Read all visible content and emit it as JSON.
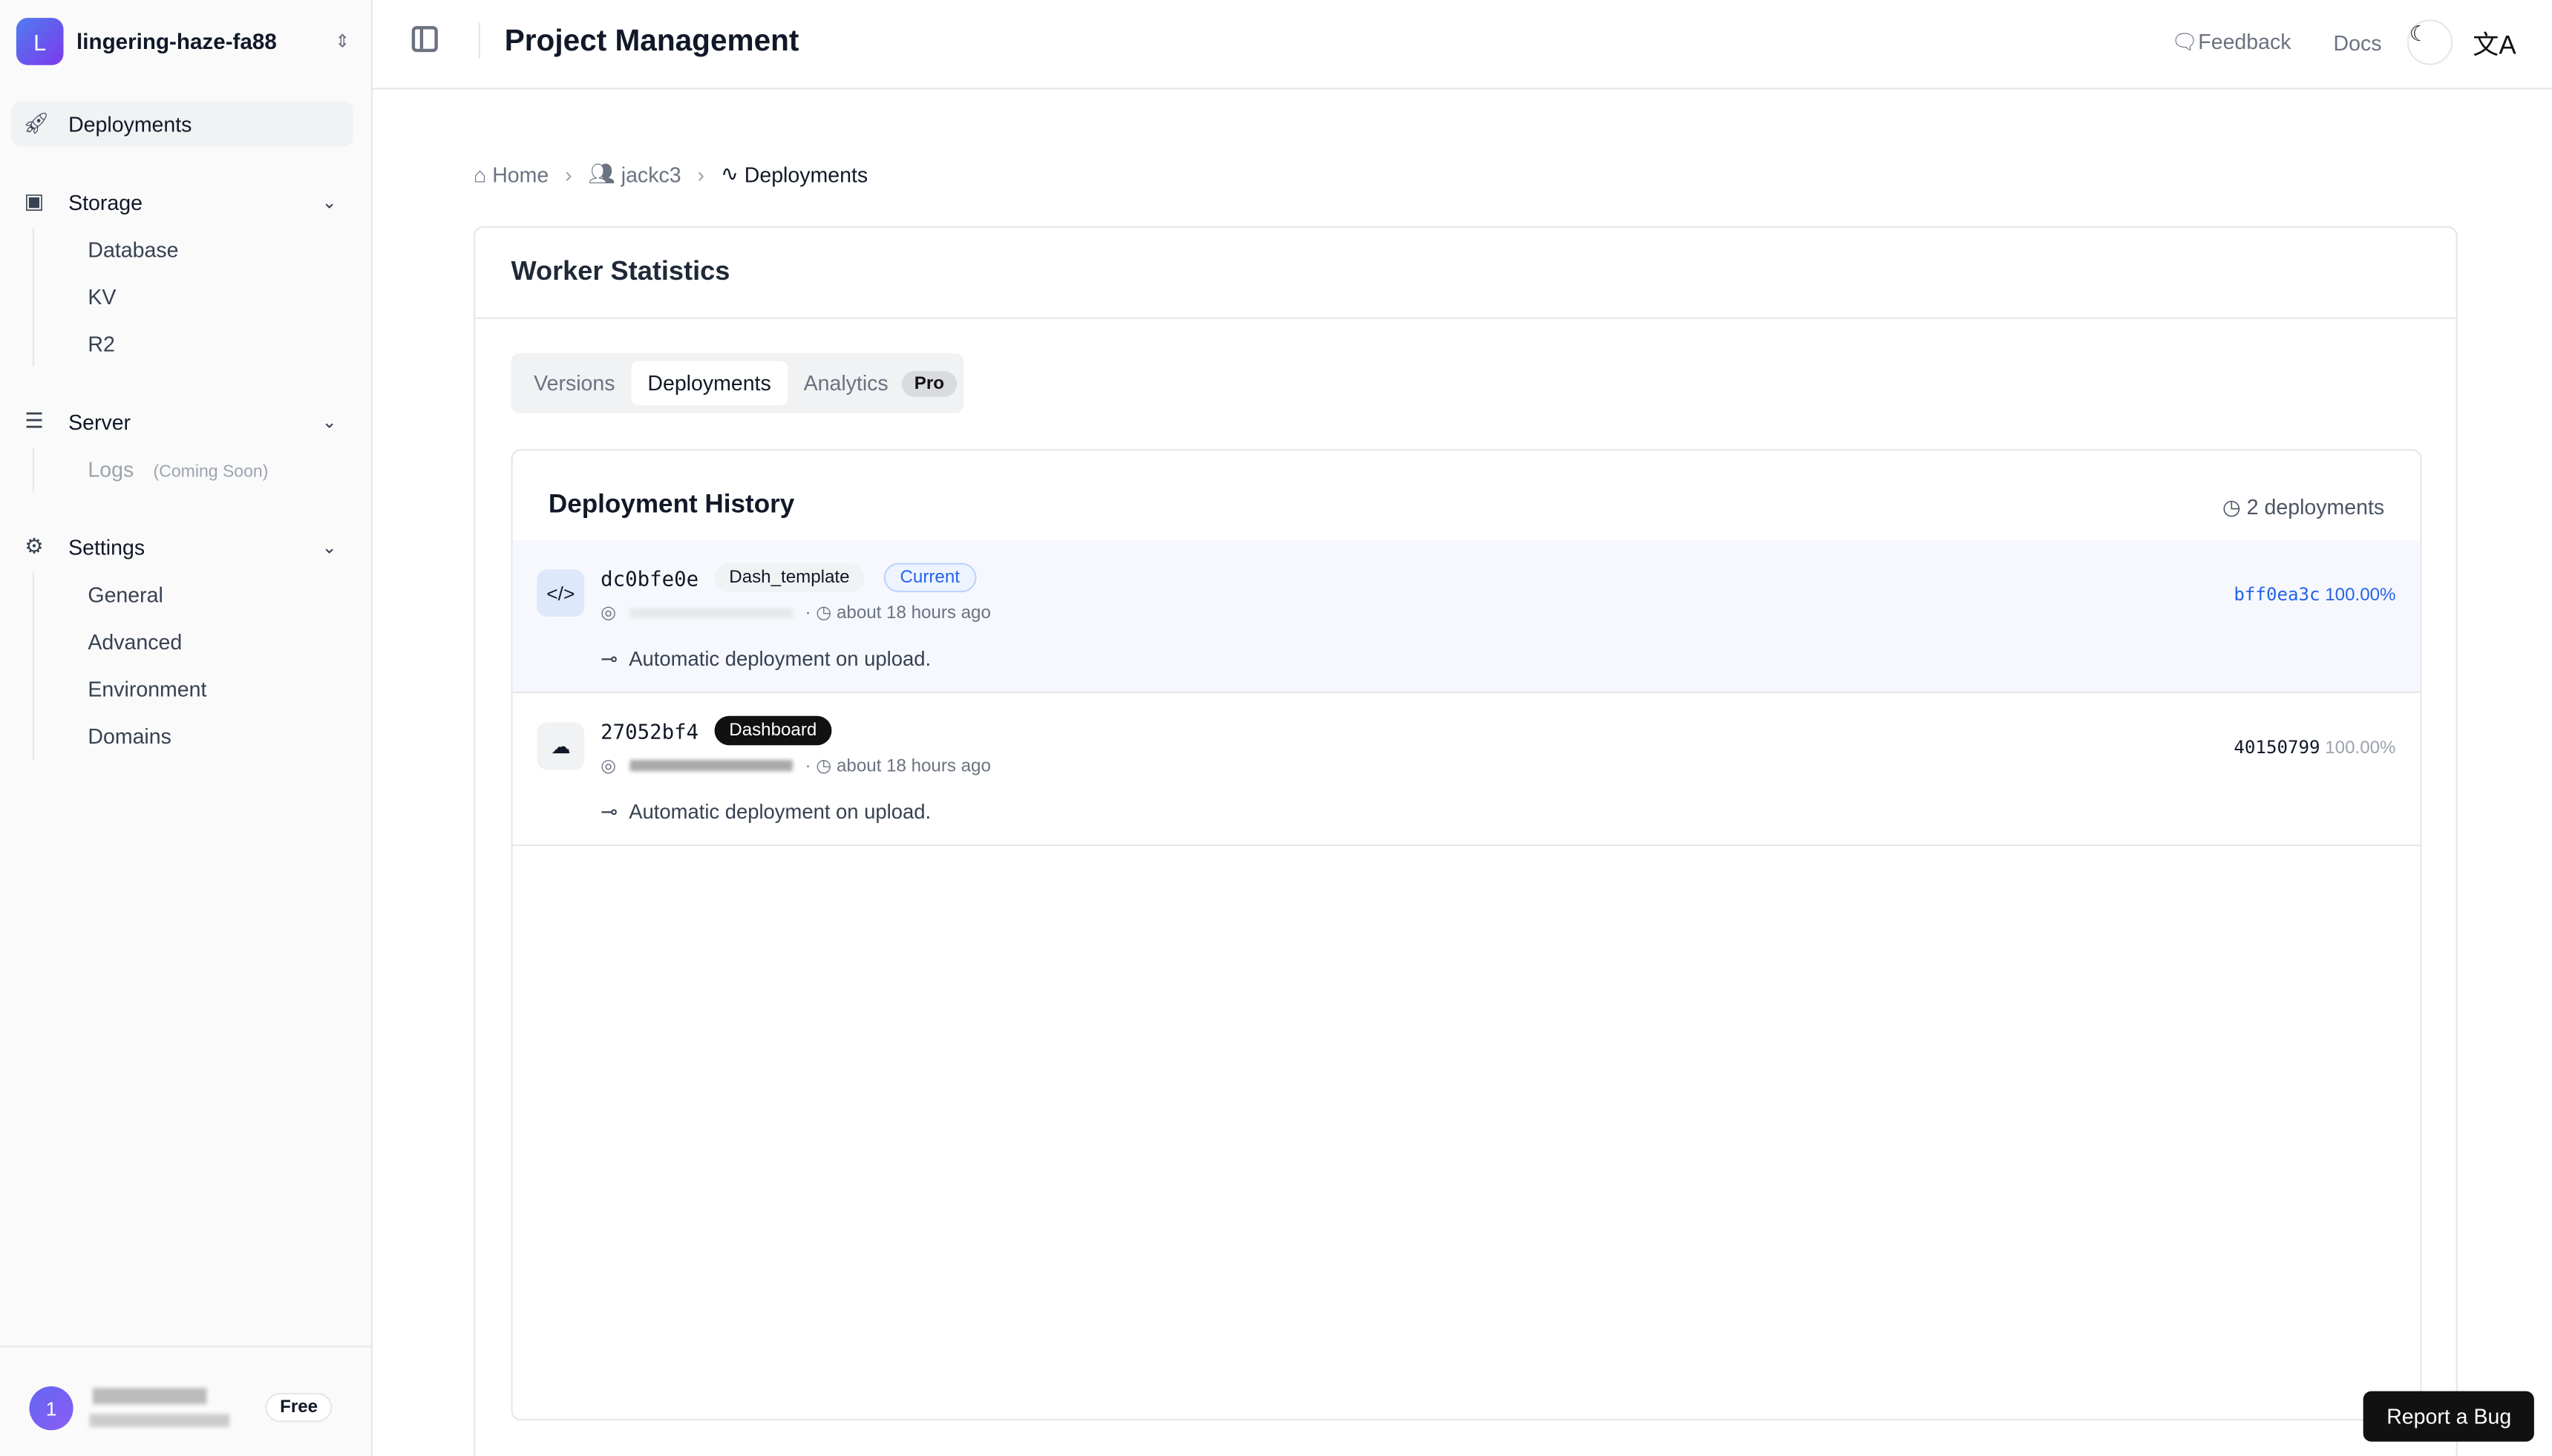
{
  "project": {
    "initial": "L",
    "name": "lingering-haze-fa88"
  },
  "nav": {
    "deployments": "Deployments",
    "storage": "Storage",
    "storage_items": [
      "Database",
      "KV",
      "R2"
    ],
    "server": "Server",
    "logs": "Logs",
    "coming_soon": "(Coming Soon)",
    "settings": "Settings",
    "settings_items": [
      "General",
      "Advanced",
      "Environment",
      "Domains"
    ]
  },
  "user": {
    "avatar": "1",
    "plan": "Free"
  },
  "header": {
    "title": "Project Management",
    "feedback": "Feedback",
    "docs": "Docs"
  },
  "breadcrumb": [
    "Home",
    "jackc3",
    "Deployments"
  ],
  "card": {
    "title": "Worker Statistics",
    "tabs": [
      "Versions",
      "Deployments",
      "Analytics"
    ],
    "pro": "Pro",
    "active_tab": "Deployments"
  },
  "history": {
    "title": "Deployment History",
    "count": "2 deployments",
    "rows": [
      {
        "hash": "dc0bfe0e",
        "tag": "Dash_template",
        "badge": "Current",
        "time": "about 18 hours ago",
        "message": "Automatic deployment on upload.",
        "version": "bff0ea3c",
        "percent": "100.00%"
      },
      {
        "hash": "27052bf4",
        "tag": "Dashboard",
        "time": "about 18 hours ago",
        "message": "Automatic deployment on upload.",
        "version": "40150799",
        "percent": "100.00%"
      }
    ]
  },
  "report_bug": "Report a Bug",
  "colors": {
    "accent": "#2563eb",
    "brand_gradient_start": "#4f7cf0",
    "brand_gradient_end": "#7c3aed"
  }
}
